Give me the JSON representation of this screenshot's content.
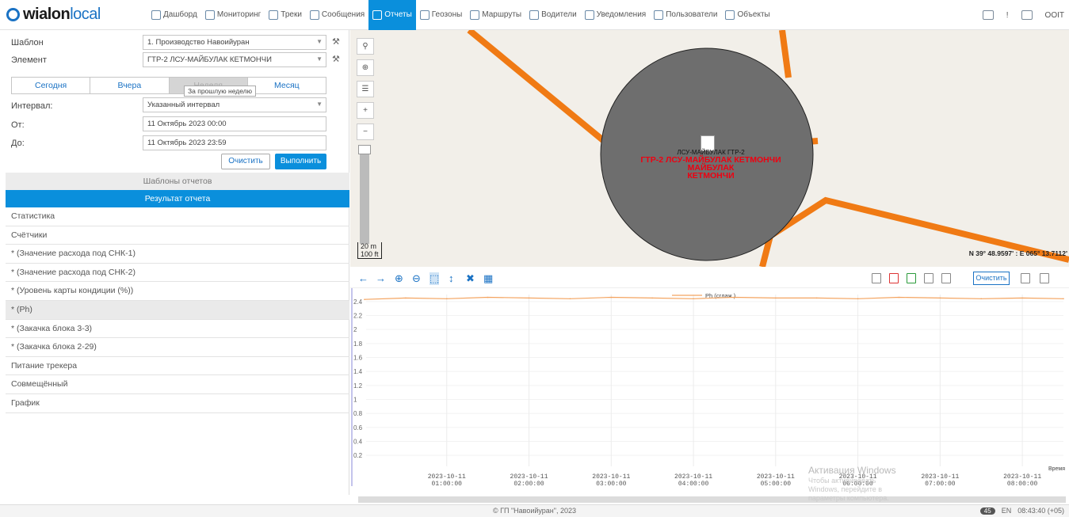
{
  "brand": {
    "logo_part1": "wialon",
    "logo_part2": "local"
  },
  "nav": [
    {
      "label": "Дашборд",
      "icon": "dashboard-icon",
      "active": false
    },
    {
      "label": "Мониторинг",
      "icon": "monitoring-icon",
      "active": false
    },
    {
      "label": "Треки",
      "icon": "tracks-icon",
      "active": false
    },
    {
      "label": "Сообщения",
      "icon": "messages-icon",
      "active": false
    },
    {
      "label": "Отчеты",
      "icon": "reports-icon",
      "active": true
    },
    {
      "label": "Геозоны",
      "icon": "geozones-icon",
      "active": false
    },
    {
      "label": "Маршруты",
      "icon": "routes-icon",
      "active": false
    },
    {
      "label": "Водители",
      "icon": "drivers-icon",
      "active": false
    },
    {
      "label": "Уведомления",
      "icon": "notifications-icon",
      "active": false
    },
    {
      "label": "Пользователи",
      "icon": "users-icon",
      "active": false
    },
    {
      "label": "Объекты",
      "icon": "objects-icon",
      "active": false
    }
  ],
  "topright": {
    "user": "OOIT"
  },
  "form": {
    "template_label": "Шаблон",
    "template_value": "1. Производство Навоийуран",
    "element_label": "Элемент",
    "element_value": "ГТР-2 ЛСУ-МАЙБУЛАК КЕТМОНЧИ",
    "period_tabs": [
      "Сегодня",
      "Вчера",
      "Неделя",
      "Месяц"
    ],
    "selected_tab": "Неделя",
    "tooltip": "За прошлую неделю",
    "interval_label": "Интервал:",
    "interval_value": "Указанный интервал",
    "from_label": "От:",
    "from_value": "11 Октябрь 2023 00:00",
    "to_label": "До:",
    "to_value": "11 Октябрь 2023 23:59",
    "clear_button": "Очистить",
    "run_button": "Выполнить"
  },
  "sections": {
    "templates": "Шаблоны отчетов",
    "result": "Результат отчета"
  },
  "result_items": [
    {
      "label": "Статистика",
      "highlight": false
    },
    {
      "label": "Счётчики",
      "highlight": false
    },
    {
      "label": "* (Значение расхода под СНК-1)",
      "highlight": false
    },
    {
      "label": "* (Значение расхода под СНК-2)",
      "highlight": false
    },
    {
      "label": "* (Уровень карты кондиции (%))",
      "highlight": false
    },
    {
      "label": "* (Ph)",
      "highlight": true
    },
    {
      "label": "* (Закачка блока 3-3)",
      "highlight": false
    },
    {
      "label": "* (Закачка блока 2-29)",
      "highlight": false
    },
    {
      "label": "Питание трекера",
      "highlight": false
    },
    {
      "label": "Совмещённый",
      "highlight": false
    },
    {
      "label": "График",
      "highlight": false
    }
  ],
  "map": {
    "unit_label_small": "ЛСУ-МАЙБУЛАК ГТР-2",
    "unit_label_line1": "ГТР-2 ЛСУ-МАЙБУЛАК КЕТМОНЧИ",
    "unit_label_line2": "МАЙБУЛАК",
    "unit_label_line3": "КЕТМОНЧИ",
    "scale_label_m": "20 m",
    "scale_label_ft": "100 ft",
    "coords": "N 39° 48.9597' : E 065° 13.7112'",
    "geofence_color": "#6e6e6e",
    "road_color": "#f07a14"
  },
  "chart_toolbar": {
    "clear_button": "Очистить"
  },
  "chart_data": {
    "type": "line",
    "series": [
      {
        "name": "Ph (сглаж.)",
        "color": "#f4a460",
        "x": [
          "2023-10-11 00:00:00",
          "2023-10-11 00:30:00",
          "2023-10-11 01:00:00",
          "2023-10-11 01:30:00",
          "2023-10-11 02:00:00",
          "2023-10-11 02:30:00",
          "2023-10-11 03:00:00",
          "2023-10-11 03:30:00",
          "2023-10-11 04:00:00",
          "2023-10-11 04:30:00",
          "2023-10-11 05:00:00",
          "2023-10-11 05:30:00",
          "2023-10-11 06:00:00",
          "2023-10-11 06:30:00",
          "2023-10-11 07:00:00",
          "2023-10-11 07:30:00",
          "2023-10-11 08:00:00",
          "2023-10-11 08:30:00"
        ],
        "values": [
          2.43,
          2.45,
          2.44,
          2.46,
          2.45,
          2.44,
          2.46,
          2.45,
          2.44,
          2.46,
          2.45,
          2.45,
          2.44,
          2.46,
          2.45,
          2.44,
          2.45,
          2.44
        ]
      }
    ],
    "yticks": [
      "2.4",
      "2.2",
      "2",
      "1.8",
      "1.6",
      "1.4",
      "1.2",
      "1",
      "0.8",
      "0.6",
      "0.4",
      "0.2"
    ],
    "xticks": [
      {
        "date": "2023-10-11",
        "time": "01:00:00"
      },
      {
        "date": "2023-10-11",
        "time": "02:00:00"
      },
      {
        "date": "2023-10-11",
        "time": "03:00:00"
      },
      {
        "date": "2023-10-11",
        "time": "04:00:00"
      },
      {
        "date": "2023-10-11",
        "time": "05:00:00"
      },
      {
        "date": "2023-10-11",
        "time": "06:00:00"
      },
      {
        "date": "2023-10-11",
        "time": "07:00:00"
      },
      {
        "date": "2023-10-11",
        "time": "08:00:00"
      }
    ],
    "ylim": [
      0.1,
      2.5
    ],
    "xlabel": "Время",
    "ylabel": "",
    "grid": true,
    "legend": "top-center"
  },
  "watermark": {
    "title": "Активация Windows",
    "text": "Чтобы активировать Windows, перейдите в параметры компьютера."
  },
  "footer": {
    "copyright": "© ГП \"Навоийуран\", 2023",
    "badge": "45",
    "lang": "EN",
    "time": "08:43:40 (+05)"
  }
}
